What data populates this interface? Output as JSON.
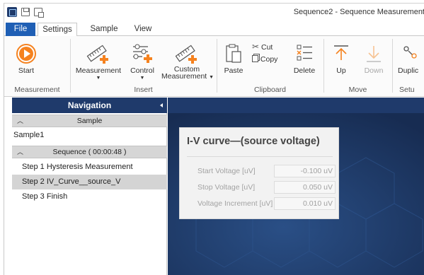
{
  "window": {
    "title": "Sequence2 - Sequence Measurement"
  },
  "tabs": [
    {
      "label": "File"
    },
    {
      "label": "Settings"
    },
    {
      "label": "Sample"
    },
    {
      "label": "View"
    }
  ],
  "ribbon": {
    "start": "Start",
    "measurement": "Measurement",
    "control": "Control",
    "custom_line1": "Custom",
    "custom_line2": "Measurement",
    "paste": "Paste",
    "cut": "Cut",
    "copy": "Copy",
    "delete": "Delete",
    "up": "Up",
    "down": "Down",
    "duplicate": "Duplic",
    "groups": {
      "measurement": "Measurement",
      "insert": "Insert",
      "clipboard": "Clipboard",
      "move": "Move",
      "setup": "Setu"
    }
  },
  "navigation": {
    "header": "Navigation",
    "sample_group": "Sample",
    "sample_item": "Sample1",
    "sequence_group": "Sequence ( 00:00:48 )",
    "steps": [
      "Step 1 Hysteresis Measurement",
      "Step 2 IV_Curve__source_V",
      "Step 3 Finish"
    ]
  },
  "card": {
    "title": "I-V curve—(source voltage)",
    "fields": [
      {
        "label": "Start Voltage [uV]",
        "value": "-0.100 uV"
      },
      {
        "label": "Stop Voltage [uV]",
        "value": "0.050 uV"
      },
      {
        "label": "Voltage Increment [uV]",
        "value": "0.010 uV"
      }
    ]
  },
  "colors": {
    "accent": "#1f5fb5",
    "navy": "#1f3a6b",
    "start_orange": "#f5821f"
  }
}
